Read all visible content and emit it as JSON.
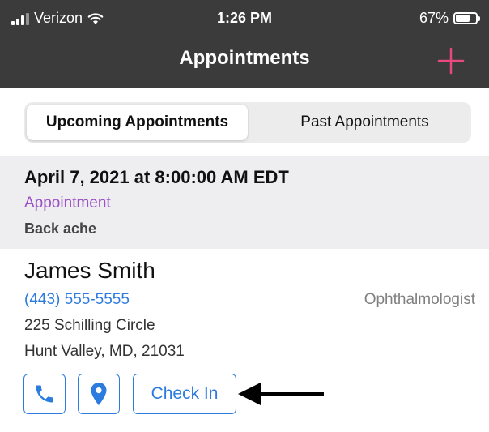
{
  "status_bar": {
    "carrier": "Verizon",
    "time": "1:26 PM",
    "battery": "67%",
    "battery_level": 0.67,
    "icons": [
      "signal-icon",
      "wifi-icon",
      "battery-icon"
    ]
  },
  "nav": {
    "title": "Appointments",
    "add_icon": "plus-icon",
    "accent": "#e8497d"
  },
  "tabs": [
    {
      "label": "Upcoming Appointments",
      "selected": true
    },
    {
      "label": "Past Appointments",
      "selected": false
    }
  ],
  "appointment": {
    "datetime": "April 7, 2021 at 8:00:00 AM EDT",
    "type": "Appointment",
    "reason": "Back ache",
    "doctor": {
      "name": "James Smith",
      "phone": "(443) 555-5555",
      "specialty": "Ophthalmologist",
      "address_line1": "225 Schilling Circle",
      "address_line2": "Hunt Valley, MD, 21031"
    },
    "actions": {
      "call_icon": "phone-icon",
      "location_icon": "location-pin-icon",
      "check_in_label": "Check In"
    }
  },
  "colors": {
    "header_bg": "#3b3b3b",
    "link_blue": "#2c7bdf",
    "type_purple": "#9b4fc9",
    "section_bg": "#eeeef0"
  }
}
